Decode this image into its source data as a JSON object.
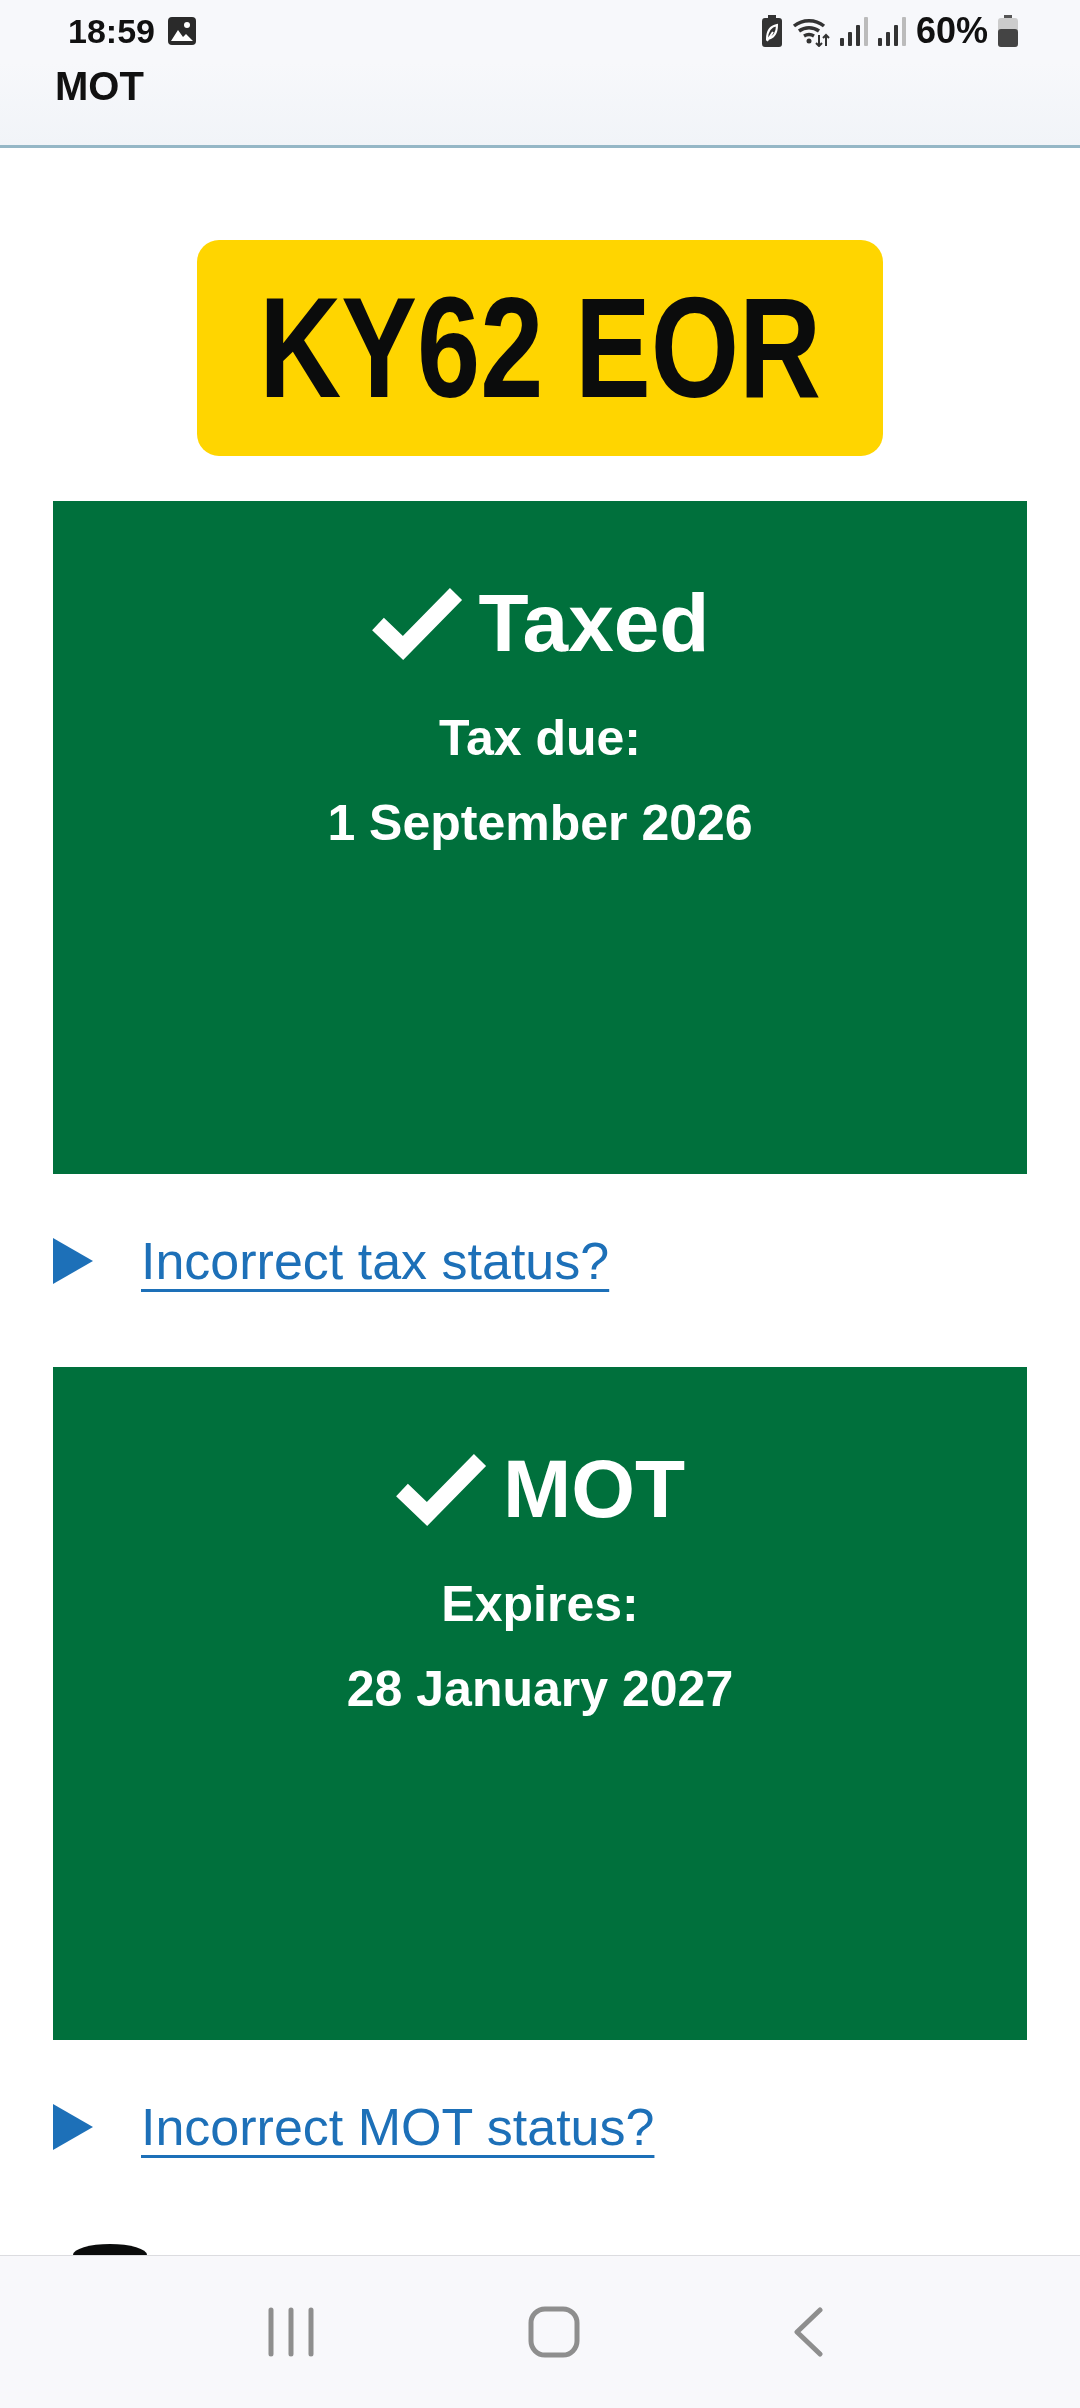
{
  "status_bar": {
    "time": "18:59",
    "battery": "60%"
  },
  "header": {
    "title": "MOT"
  },
  "plate": {
    "registration": "KY62 EOR"
  },
  "checks": [
    {
      "kind": "valid",
      "title": "Taxed",
      "label": "Tax due:",
      "date": "1 September 2026",
      "link": "Incorrect tax status?"
    },
    {
      "kind": "valid",
      "title": "MOT",
      "label": "Expires:",
      "date": "28 January 2027",
      "link": "Incorrect MOT status?"
    }
  ]
}
